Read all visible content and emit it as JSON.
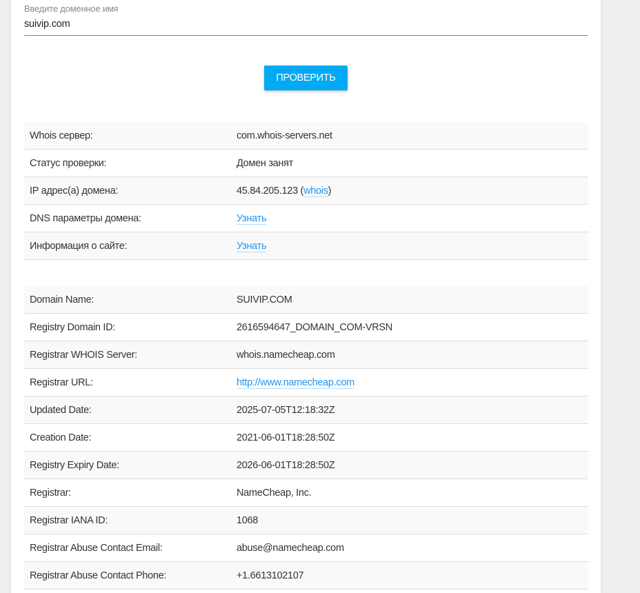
{
  "form": {
    "label": "Введите доменное имя",
    "value": "suivip.com",
    "button": "ПРОВЕРИТЬ"
  },
  "summary": [
    {
      "key": "Whois сервер:",
      "value": "com.whois-servers.net"
    },
    {
      "key": "Статус проверки:",
      "value": "Домен занят"
    },
    {
      "key": "IP адрес(а) домена:",
      "value": "45.84.205.123",
      "link": "whois"
    },
    {
      "key": "DNS параметры домена:",
      "link": "Узнать"
    },
    {
      "key": "Информация о сайте:",
      "link": "Узнать"
    }
  ],
  "whois": [
    {
      "key": "Domain Name:",
      "value": "SUIVIP.COM"
    },
    {
      "key": "Registry Domain ID:",
      "value": "2616594647_DOMAIN_COM-VRSN"
    },
    {
      "key": "Registrar WHOIS Server:",
      "value": "whois.namecheap.com"
    },
    {
      "key": "Registrar URL:",
      "link": "http://www.namecheap.com"
    },
    {
      "key": "Updated Date:",
      "value": "2025-07-05T12:18:32Z"
    },
    {
      "key": "Creation Date:",
      "value": "2021-06-01T18:28:50Z"
    },
    {
      "key": "Registry Expiry Date:",
      "value": "2026-06-01T18:28:50Z"
    },
    {
      "key": "Registrar:",
      "value": "NameCheap, Inc."
    },
    {
      "key": "Registrar IANA ID:",
      "value": "1068"
    },
    {
      "key": "Registrar Abuse Contact Email:",
      "value": "abuse@namecheap.com"
    },
    {
      "key": "Registrar Abuse Contact Phone:",
      "value": "+1.6613102107"
    }
  ]
}
